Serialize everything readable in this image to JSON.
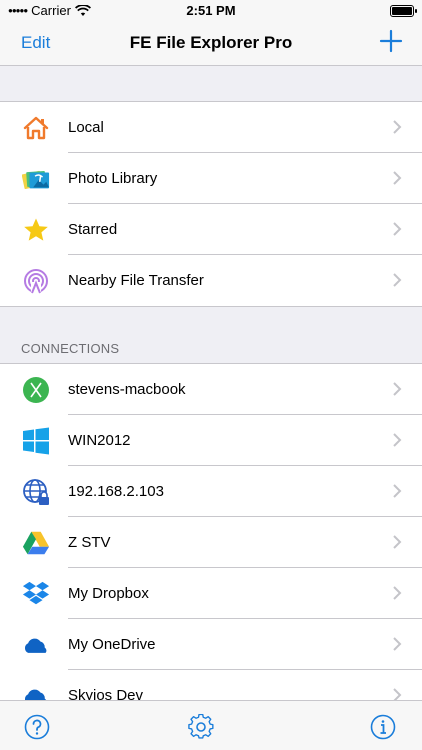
{
  "status": {
    "carrier": "Carrier",
    "time": "2:51 PM"
  },
  "nav": {
    "edit_label": "Edit",
    "title": "FE File Explorer Pro"
  },
  "places": [
    {
      "label": "Local",
      "icon": "home-icon"
    },
    {
      "label": "Photo Library",
      "icon": "photo-library-icon"
    },
    {
      "label": "Starred",
      "icon": "star-icon"
    },
    {
      "label": "Nearby File Transfer",
      "icon": "nearby-transfer-icon"
    }
  ],
  "connections": {
    "header": "CONNECTIONS",
    "items": [
      {
        "label": "stevens-macbook",
        "icon": "macos-server-icon"
      },
      {
        "label": "WIN2012",
        "icon": "windows-icon"
      },
      {
        "label": "192.168.2.103",
        "icon": "globe-lock-icon"
      },
      {
        "label": "Z STV",
        "icon": "google-drive-icon"
      },
      {
        "label": "My Dropbox",
        "icon": "dropbox-icon"
      },
      {
        "label": "My OneDrive",
        "icon": "onedrive-icon"
      },
      {
        "label": "Skyjos Dev",
        "icon": "onedrive-icon"
      }
    ]
  },
  "colors": {
    "accent": "#1a7dda",
    "separator": "#c8c7cc",
    "background": "#efeff4"
  }
}
